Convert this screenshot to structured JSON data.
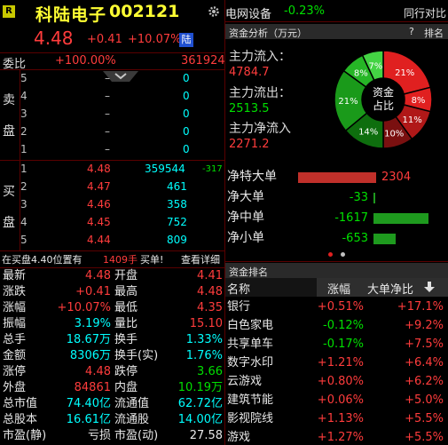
{
  "header": {
    "badge": "R",
    "stock_name": "科陆电子",
    "stock_code": "002121",
    "price": "4.48",
    "change": "+0.41",
    "change_pct": "+10.07%",
    "market_tag": "陆",
    "sector_name": "电网设备",
    "sector_change": "-0.23%",
    "compare_label": "同行对比"
  },
  "weibi": {
    "label": "委比",
    "pct": "+100.00%",
    "diff": "361924"
  },
  "sell_label": [
    "卖",
    "盘"
  ],
  "buy_label": [
    "买",
    "盘"
  ],
  "sell": [
    {
      "level": "5",
      "price": "–",
      "vol": "0"
    },
    {
      "level": "4",
      "price": "–",
      "vol": "0"
    },
    {
      "level": "3",
      "price": "–",
      "vol": "0"
    },
    {
      "level": "2",
      "price": "–",
      "vol": "0"
    },
    {
      "level": "1",
      "price": "–",
      "vol": "0"
    }
  ],
  "buy": [
    {
      "level": "1",
      "price": "4.48",
      "vol": "359544",
      "delta": "-317"
    },
    {
      "level": "2",
      "price": "4.47",
      "vol": "461",
      "delta": ""
    },
    {
      "level": "3",
      "price": "4.46",
      "vol": "358",
      "delta": ""
    },
    {
      "level": "4",
      "price": "4.45",
      "vol": "752",
      "delta": ""
    },
    {
      "level": "5",
      "price": "4.44",
      "vol": "809",
      "delta": ""
    }
  ],
  "trade_bar": {
    "text": "在买盘4.40位置有",
    "vol": "1409手",
    "action": "买单!",
    "detail": "查看详细"
  },
  "stats": [
    {
      "l1": "最新",
      "v1": "4.48",
      "c1": "red",
      "l2": "开盘",
      "v2": "4.41",
      "c2": "red"
    },
    {
      "l1": "涨跌",
      "v1": "+0.41",
      "c1": "red",
      "l2": "最高",
      "v2": "4.48",
      "c2": "red"
    },
    {
      "l1": "涨幅",
      "v1": "+10.07%",
      "c1": "red",
      "l2": "最低",
      "v2": "4.35",
      "c2": "red"
    },
    {
      "l1": "振幅",
      "v1": "3.19%",
      "c1": "cyan",
      "l2": "量比",
      "v2": "15.10",
      "c2": "red"
    },
    {
      "l1": "总手",
      "v1": "18.67万",
      "c1": "cyan",
      "l2": "换手",
      "v2": "1.33%",
      "c2": "cyan"
    },
    {
      "l1": "金额",
      "v1": "8306万",
      "c1": "cyan",
      "l2": "换手(实)",
      "v2": "1.76%",
      "c2": "cyan"
    },
    {
      "l1": "涨停",
      "v1": "4.48",
      "c1": "red",
      "l2": "跌停",
      "v2": "3.66",
      "c2": "green"
    },
    {
      "l1": "外盘",
      "v1": "84861",
      "c1": "red",
      "l2": "内盘",
      "v2": "10.19万",
      "c2": "green"
    },
    {
      "l1": "总市值",
      "v1": "74.40亿",
      "c1": "cyan",
      "l2": "流通值",
      "v2": "62.72亿",
      "c2": "cyan"
    },
    {
      "l1": "总股本",
      "v1": "16.61亿",
      "c1": "cyan",
      "l2": "流通股",
      "v2": "14.00亿",
      "c2": "cyan"
    },
    {
      "l1": "市盈(静)",
      "v1": "亏损",
      "c1": "white",
      "l2": "市盈(动)",
      "v2": "27.58",
      "c2": "white"
    }
  ],
  "fund": {
    "title": "资金分析（万元）",
    "help": "?",
    "rank_btn": "排名",
    "inflow_label": "主力流入：",
    "inflow": "4784.7",
    "outflow_label": "主力流出：",
    "outflow": "2513.5",
    "net_label": "主力净流入",
    "net": "2271.2",
    "donut_center": [
      "资金",
      "占比"
    ],
    "donut": [
      {
        "label": "21%",
        "value": 21,
        "color": "#e02020"
      },
      {
        "label": "8%",
        "value": 8,
        "color": "#e02020"
      },
      {
        "label": "11%",
        "value": 11,
        "color": "#b01818"
      },
      {
        "label": "10%",
        "value": 10,
        "color": "#7a1010"
      },
      {
        "label": "14%",
        "value": 14,
        "color": "#0e6e0e"
      },
      {
        "label": "21%",
        "value": 21,
        "color": "#1a9a1a"
      },
      {
        "label": "8%",
        "value": 8,
        "color": "#26b626"
      },
      {
        "label": "7%",
        "value": 7,
        "color": "#44d444"
      }
    ],
    "flows": [
      {
        "label": "净特大单",
        "value": "2304",
        "num": 2304,
        "color": "#c0302a"
      },
      {
        "label": "净大单",
        "value": "-33",
        "num": -33,
        "color": "#1e9a1e"
      },
      {
        "label": "净中单",
        "value": "-1617",
        "num": -1617,
        "color": "#1e9a1e"
      },
      {
        "label": "净小单",
        "value": "-653",
        "num": -653,
        "color": "#1e9a1e"
      }
    ]
  },
  "rank": {
    "title": "资金排名",
    "col_name": "名称",
    "col_change": "涨幅",
    "col_ratio": "大单净比",
    "rows": [
      {
        "name": "银行",
        "change": "+0.51%",
        "ratio": "+17.1%",
        "cc": "red"
      },
      {
        "name": "白色家电",
        "change": "-0.12%",
        "ratio": "+9.2%",
        "cc": "green"
      },
      {
        "name": "共享单车",
        "change": "-0.17%",
        "ratio": "+7.5%",
        "cc": "green"
      },
      {
        "name": "数字水印",
        "change": "+1.21%",
        "ratio": "+6.4%",
        "cc": "red"
      },
      {
        "name": "云游戏",
        "change": "+0.80%",
        "ratio": "+6.2%",
        "cc": "red"
      },
      {
        "name": "建筑节能",
        "change": "+0.06%",
        "ratio": "+5.0%",
        "cc": "red"
      },
      {
        "name": "影视院线",
        "change": "+1.13%",
        "ratio": "+5.5%",
        "cc": "red"
      },
      {
        "name": "游戏",
        "change": "+1.27%",
        "ratio": "+5.5%",
        "cc": "red"
      }
    ]
  }
}
